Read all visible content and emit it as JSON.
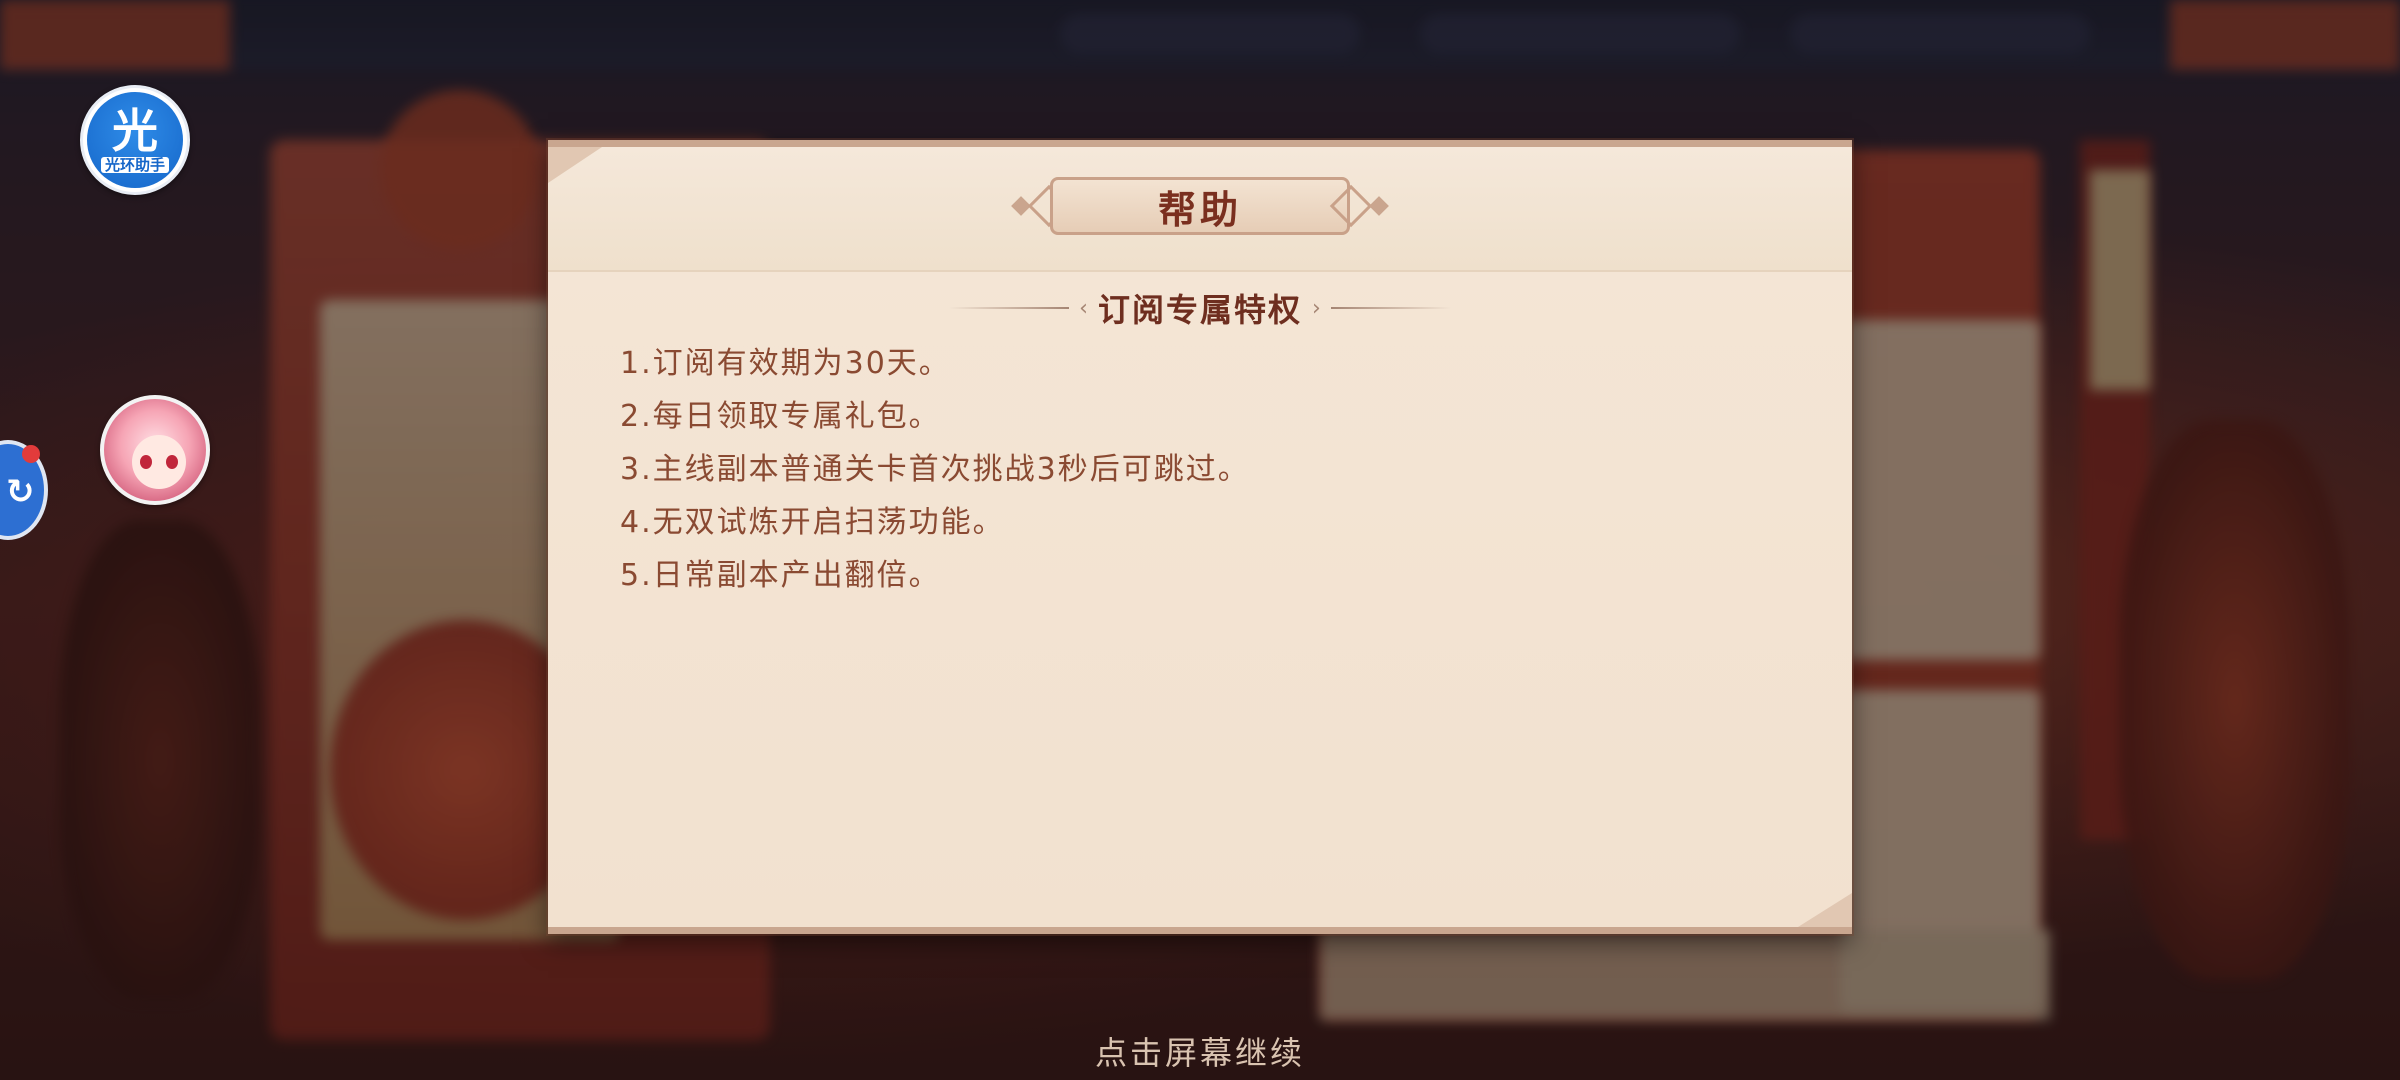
{
  "dialog": {
    "title": "帮助",
    "section_title": "订阅专属特权",
    "items": [
      "1.订阅有效期为30天。",
      "2.每日领取专属礼包。",
      "3.主线副本普通关卡首次挑战3秒后可跳过。",
      "4.无双试炼开启扫荡功能。",
      "5.日常副本产出翻倍。"
    ]
  },
  "assistant_widget": {
    "glyph": "光",
    "label": "光环助手"
  },
  "continue_hint": "点击屏幕继续",
  "colors": {
    "dialog_bg": "#f3e4d3",
    "title_text": "#7a2f1f",
    "item_text": "#8a4a32",
    "assist_blue": "#1566c9"
  }
}
